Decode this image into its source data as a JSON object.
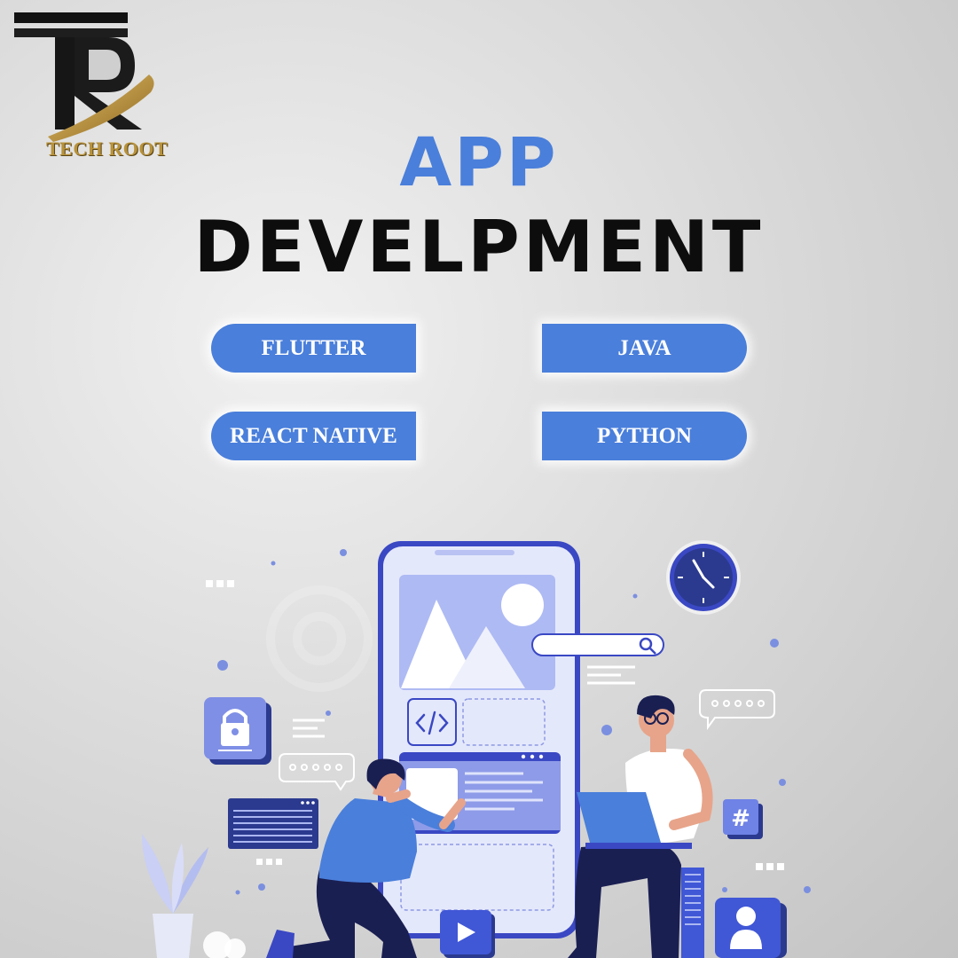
{
  "brand": {
    "name": "TECH ROOT",
    "monogram": "TR",
    "colors": {
      "gold": "#b8923a",
      "dark": "#111111"
    }
  },
  "heading": {
    "line1": "APP",
    "line2": "DEVELPMENT"
  },
  "technologies": [
    "FLUTTER",
    "JAVA",
    "REACT NATIVE",
    "PYTHON"
  ],
  "illustration": {
    "icons": [
      "phone-mockup",
      "image-placeholder-icon",
      "code-icon",
      "search-bar",
      "clock-icon",
      "lock-icon",
      "chat-bubble-icon",
      "hash-icon",
      "user-icon",
      "play-icon",
      "plant-icon",
      "laptop"
    ]
  },
  "colors": {
    "accent": "#4a7fdb",
    "heading_dark": "#0d0d0d",
    "illustration_navy": "#2b3a8f",
    "illustration_lavender": "#c9cff5"
  }
}
